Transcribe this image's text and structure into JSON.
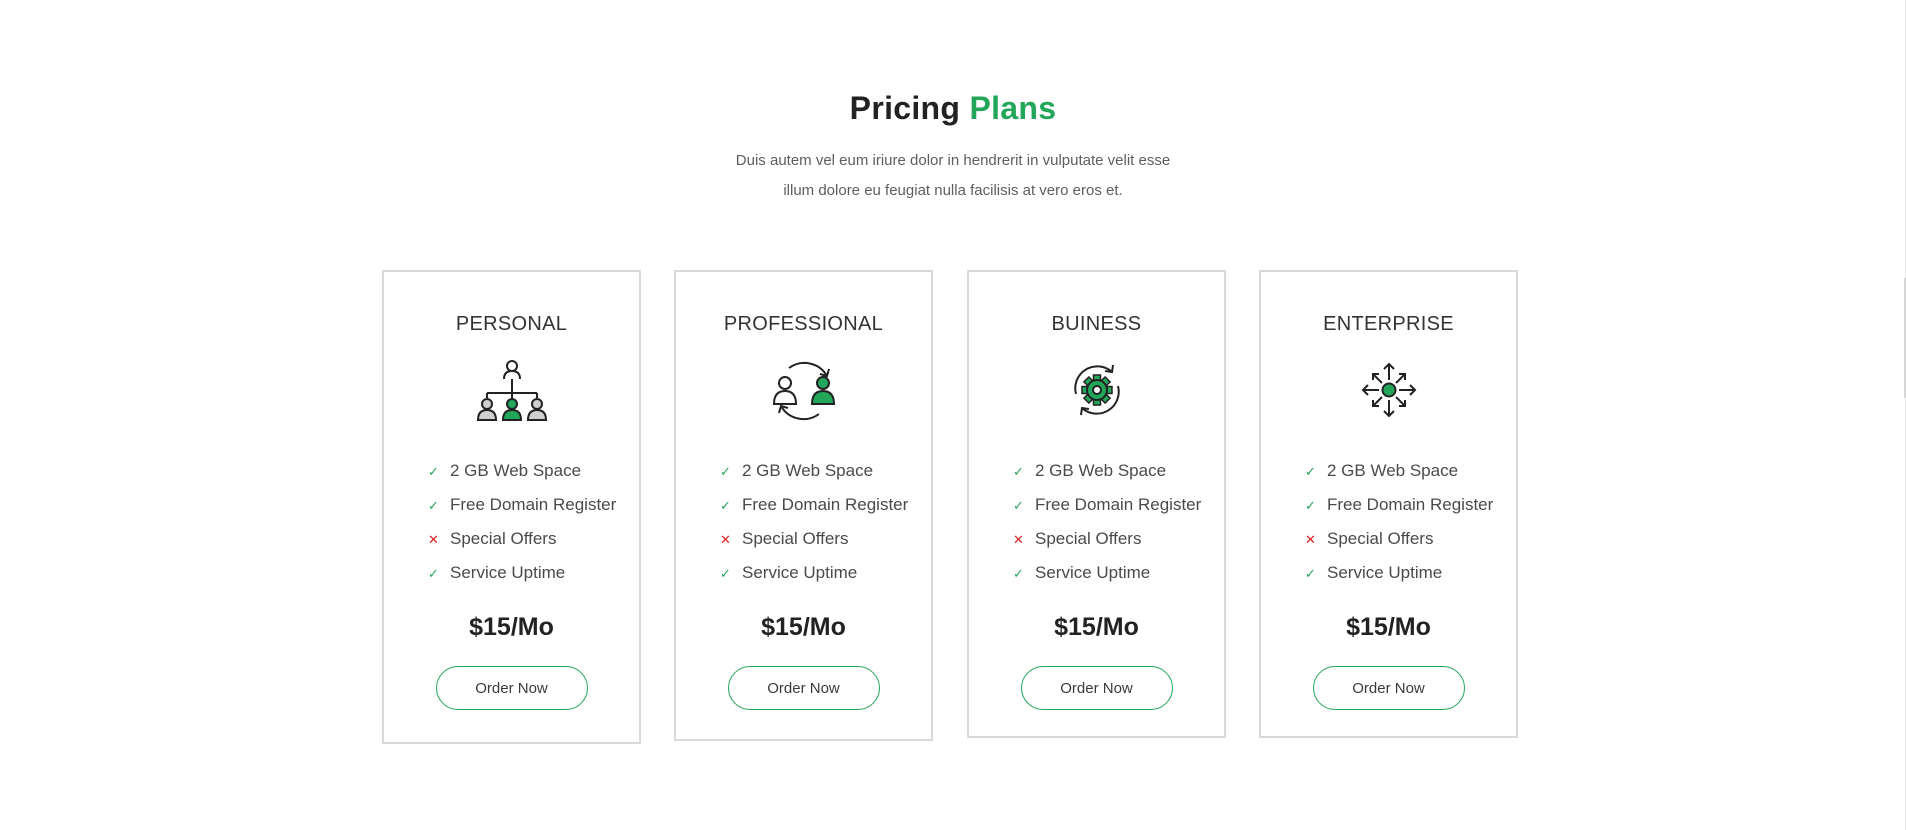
{
  "header": {
    "title_main": "Pricing",
    "title_accent": "Plans",
    "subtitle_line1": "Duis autem vel eum iriure dolor in hendrerit in vulputate velit esse",
    "subtitle_line2": "illum dolore eu feugiat nulla facilisis at vero eros et."
  },
  "colors": {
    "accent": "#22a65a",
    "cross": "#e01f1f",
    "border": "#d9d9d9"
  },
  "marks": {
    "yes": "✓",
    "no": "✕"
  },
  "plans": [
    {
      "name": "PERSONAL",
      "icon": "organization-hierarchy-icon",
      "features": [
        {
          "label": "2 GB Web Space",
          "included": true
        },
        {
          "label": "Free Domain Register",
          "included": true
        },
        {
          "label": "Special Offers",
          "included": false
        },
        {
          "label": "Service Uptime",
          "included": true
        }
      ],
      "price": "$15/Mo",
      "button": "Order Now"
    },
    {
      "name": "PROFESSIONAL",
      "icon": "user-exchange-icon",
      "features": [
        {
          "label": "2 GB Web Space",
          "included": true
        },
        {
          "label": "Free Domain Register",
          "included": true
        },
        {
          "label": "Special Offers",
          "included": false
        },
        {
          "label": "Service Uptime",
          "included": true
        }
      ],
      "price": "$15/Mo",
      "button": "Order Now"
    },
    {
      "name": "BUINESS",
      "icon": "gear-sync-icon",
      "features": [
        {
          "label": "2 GB Web Space",
          "included": true
        },
        {
          "label": "Free Domain Register",
          "included": true
        },
        {
          "label": "Special Offers",
          "included": false
        },
        {
          "label": "Service Uptime",
          "included": true
        }
      ],
      "price": "$15/Mo",
      "button": "Order Now"
    },
    {
      "name": "ENTERPRISE",
      "icon": "expand-arrows-icon",
      "features": [
        {
          "label": "2 GB Web Space",
          "included": true
        },
        {
          "label": "Free Domain Register",
          "included": true
        },
        {
          "label": "Special Offers",
          "included": false
        },
        {
          "label": "Service Uptime",
          "included": true
        }
      ],
      "price": "$15/Mo",
      "button": "Order Now"
    }
  ]
}
